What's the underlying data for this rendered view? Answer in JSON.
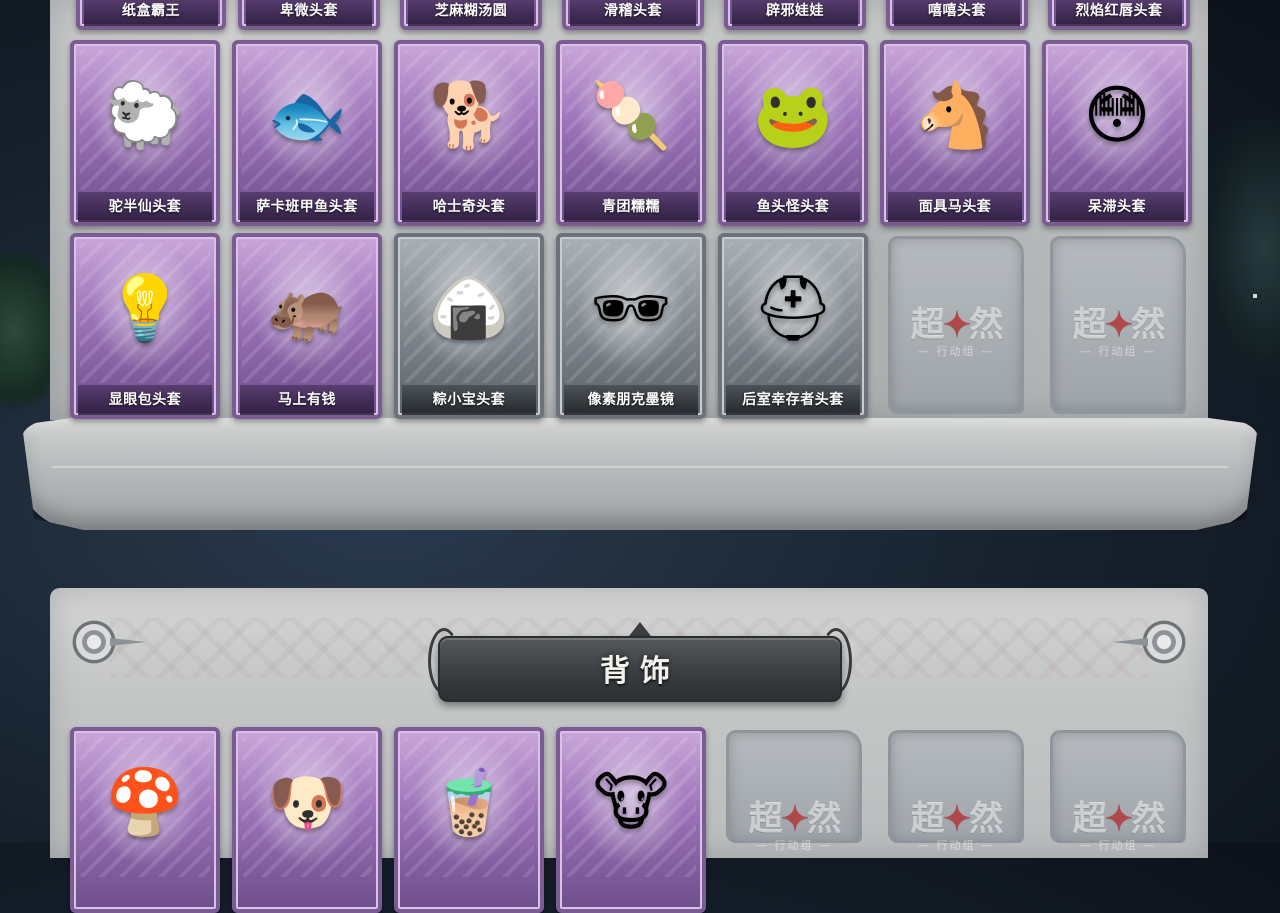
{
  "page": {
    "background": "#16202c",
    "card_purple": "#9c73b8",
    "card_grey": "#7d858d"
  },
  "top_row_cut": [
    {
      "name": "纸盒霸王",
      "rarity": "purple"
    },
    {
      "name": "卑微头套",
      "rarity": "purple"
    },
    {
      "name": "芝麻糊汤圆",
      "rarity": "purple"
    },
    {
      "name": "滑稽头套",
      "rarity": "purple"
    },
    {
      "name": "辟邪娃娃",
      "rarity": "purple"
    },
    {
      "name": "嘻嘻头套",
      "rarity": "purple"
    },
    {
      "name": "烈焰红唇头套",
      "rarity": "purple"
    }
  ],
  "row_1": [
    {
      "name": "驼半仙头套",
      "rarity": "purple",
      "icon": "alpaca-sunglasses-icon",
      "glyph": "🐑"
    },
    {
      "name": "萨卡班甲鱼头套",
      "rarity": "purple",
      "icon": "fish-head-icon",
      "glyph": "🐟"
    },
    {
      "name": "哈士奇头套",
      "rarity": "purple",
      "icon": "husky-sunglasses-icon",
      "glyph": "🐕"
    },
    {
      "name": "青团糯糯",
      "rarity": "purple",
      "icon": "green-rice-ball-icon",
      "glyph": "🍡"
    },
    {
      "name": "鱼头怪头套",
      "rarity": "purple",
      "icon": "fish-monster-icon",
      "glyph": "🐸"
    },
    {
      "name": "面具马头套",
      "rarity": "purple",
      "icon": "horse-mask-icon",
      "glyph": "🐴"
    },
    {
      "name": "呆滞头套",
      "rarity": "purple",
      "icon": "dazed-face-icon",
      "glyph": "😳"
    }
  ],
  "row_2": [
    {
      "name": "显眼包头套",
      "rarity": "purple",
      "icon": "lightbulb-crown-icon",
      "glyph": "💡"
    },
    {
      "name": "马上有钱",
      "rarity": "purple",
      "icon": "red-horse-icon",
      "glyph": "🦛"
    },
    {
      "name": "粽小宝头套",
      "rarity": "grey",
      "icon": "zongzi-icon",
      "glyph": "🍙"
    },
    {
      "name": "像素朋克墨镜",
      "rarity": "grey",
      "icon": "pixel-sunglasses-icon",
      "glyph": "🕶"
    },
    {
      "name": "后室幸存者头套",
      "rarity": "grey",
      "icon": "gas-mask-helmet-icon",
      "glyph": "⛑"
    }
  ],
  "placeholder": {
    "logo": "超自然",
    "sub": "行动组"
  },
  "section_backpack": {
    "title": "背饰"
  },
  "row_3": [
    {
      "rarity": "purple",
      "icon": "mushroom-lamp-icon",
      "glyph": "🍄"
    },
    {
      "rarity": "purple",
      "icon": "dog-top-hat-icon",
      "glyph": "🐶"
    },
    {
      "rarity": "purple",
      "icon": "milk-tea-icon",
      "glyph": "🧋"
    },
    {
      "rarity": "purple",
      "icon": "cow-bucket-icon",
      "glyph": "🐮"
    }
  ]
}
